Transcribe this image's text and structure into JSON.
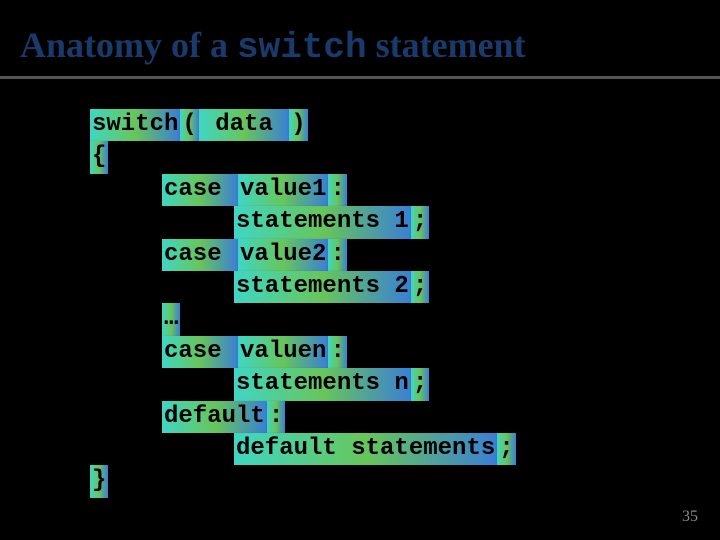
{
  "title": {
    "prefix": "Anatomy of a ",
    "mono": "switch",
    "suffix": " statement"
  },
  "code": {
    "switch_kw": "switch",
    "lparen": "(",
    "data": " data ",
    "rparen": ")",
    "lbrace": "{",
    "case1_kw": "case ",
    "case1_val": "value1",
    "case1_colon": ":",
    "stmt1": "statements 1",
    "semi1": ";",
    "case2_kw": "case ",
    "case2_val": "value2",
    "case2_colon": ":",
    "stmt2": "statements 2",
    "semi2": ";",
    "ellipsis": "…",
    "casen_kw": "case ",
    "casen_val": "valuen",
    "casen_colon": ":",
    "stmtn": "statements n",
    "semin": ";",
    "default_kw": "default",
    "default_colon": ":",
    "default_stmt": "default statements",
    "default_semi": ";",
    "rbrace": "}"
  },
  "page_number": "35"
}
